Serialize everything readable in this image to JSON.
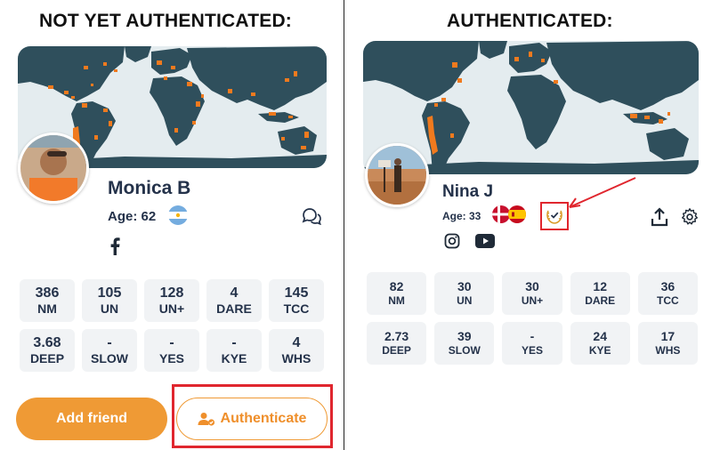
{
  "left": {
    "heading": "NOT YET AUTHENTICATED:",
    "name": "Monica B",
    "age_text": "Age: 62",
    "stats": [
      {
        "value": "386",
        "label": "NM"
      },
      {
        "value": "105",
        "label": "UN"
      },
      {
        "value": "128",
        "label": "UN+"
      },
      {
        "value": "4",
        "label": "DARE"
      },
      {
        "value": "145",
        "label": "TCC"
      },
      {
        "value": "3.68",
        "label": "DEEP"
      },
      {
        "value": "-",
        "label": "SLOW"
      },
      {
        "value": "-",
        "label": "YES"
      },
      {
        "value": "-",
        "label": "KYE"
      },
      {
        "value": "4",
        "label": "WHS"
      }
    ],
    "add_friend_label": "Add friend",
    "authenticate_label": "Authenticate"
  },
  "right": {
    "heading": "AUTHENTICATED:",
    "name": "Nina J",
    "age_text": "Age: 33",
    "stats": [
      {
        "value": "82",
        "label": "NM"
      },
      {
        "value": "30",
        "label": "UN"
      },
      {
        "value": "30",
        "label": "UN+"
      },
      {
        "value": "12",
        "label": "DARE"
      },
      {
        "value": "36",
        "label": "TCC"
      },
      {
        "value": "2.73",
        "label": "DEEP"
      },
      {
        "value": "39",
        "label": "SLOW"
      },
      {
        "value": "-",
        "label": "YES"
      },
      {
        "value": "24",
        "label": "KYE"
      },
      {
        "value": "17",
        "label": "WHS"
      }
    ]
  },
  "colors": {
    "accent_orange": "#ef9a35",
    "land": "#2f4f5c",
    "highlight_red": "#e0262e",
    "text_dark": "#24324a"
  },
  "icons": [
    "chat-icon",
    "facebook-icon",
    "instagram-icon",
    "youtube-icon",
    "share-icon",
    "gear-icon",
    "verified-badge-icon",
    "add-user-icon",
    "flag-argentina",
    "flag-denmark",
    "flag-spain"
  ]
}
